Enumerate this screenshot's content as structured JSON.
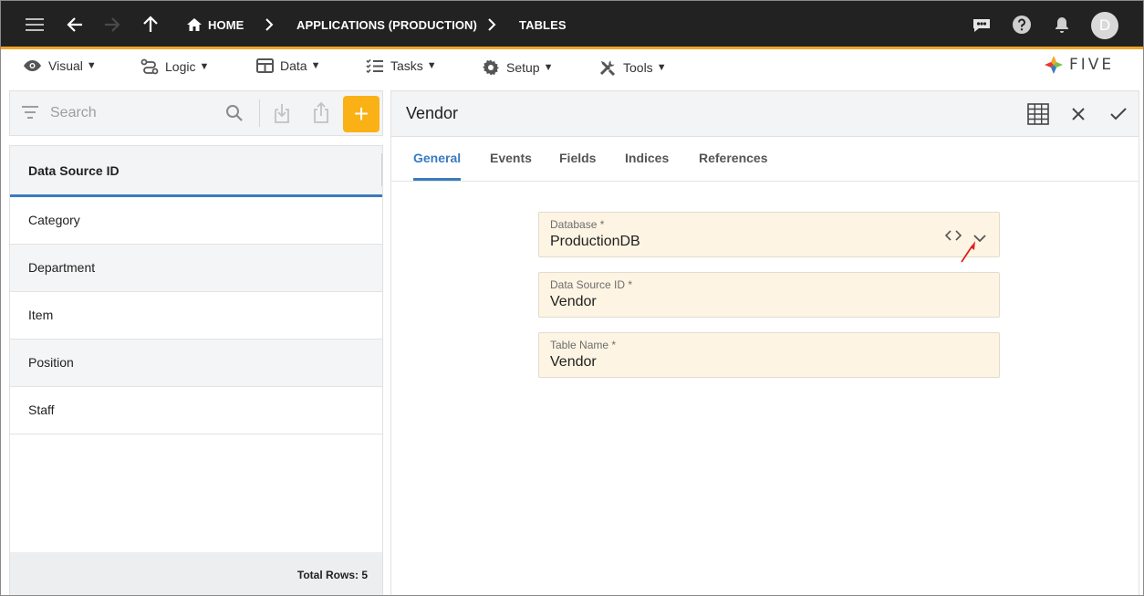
{
  "breadcrumbs": [
    "HOME",
    "APPLICATIONS (PRODUCTION)",
    "TABLES"
  ],
  "user_initial": "D",
  "menu": [
    {
      "label": "Visual",
      "icon": "eye-icon"
    },
    {
      "label": "Logic",
      "icon": "logic-flow-icon"
    },
    {
      "label": "Data",
      "icon": "table-grid-icon"
    },
    {
      "label": "Tasks",
      "icon": "checklist-icon"
    },
    {
      "label": "Setup",
      "icon": "gear-icon"
    },
    {
      "label": "Tools",
      "icon": "tools-icon"
    }
  ],
  "menu_caret": "▼",
  "logo_text": "FIVE",
  "search": {
    "placeholder": "Search"
  },
  "add_label": "+",
  "list": {
    "header": "Data Source ID",
    "rows": [
      "Category",
      "Department",
      "Item",
      "Position",
      "Staff"
    ],
    "footer": "Total Rows: 5"
  },
  "form": {
    "title": "Vendor",
    "tabs": [
      "General",
      "Events",
      "Fields",
      "Indices",
      "References"
    ],
    "active_tab": "General",
    "fields": [
      {
        "label": "Database *",
        "value": "ProductionDB"
      },
      {
        "label": "Data Source ID *",
        "value": "Vendor"
      },
      {
        "label": "Table Name *",
        "value": "Vendor"
      }
    ]
  },
  "colors": {
    "appbar": "#222222",
    "accent_orange": "#f5a623",
    "add_button": "#f9b115",
    "active_tab": "#3a7bc0",
    "field_bg": "#fdf4e3",
    "annotation_arrow": "#e02020"
  }
}
